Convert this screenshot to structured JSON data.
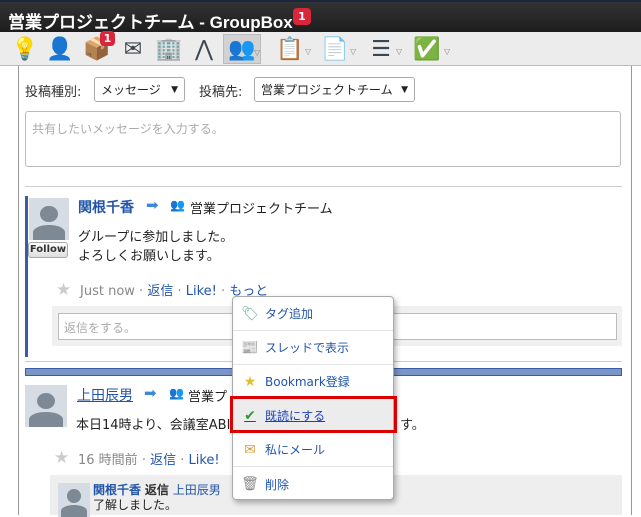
{
  "window": {
    "title": "営業プロジェクトチーム - GroupBox",
    "notification_count": "1"
  },
  "toolbar": {
    "items": [
      {
        "icon": "lightbulb-icon"
      },
      {
        "icon": "user-icon"
      },
      {
        "icon": "home-box-icon",
        "badge": "1"
      },
      {
        "icon": "mail-icon"
      },
      {
        "icon": "building-icon"
      },
      {
        "icon": "compass-icon"
      },
      {
        "icon": "group-icon",
        "active": true
      },
      {
        "icon": "clipboard-user-icon"
      },
      {
        "icon": "document-pin-icon"
      },
      {
        "icon": "list-icon"
      },
      {
        "icon": "checkbox-icon"
      }
    ]
  },
  "composer": {
    "type_label": "投稿種別:",
    "type_value": "メッセージ",
    "dest_label": "投稿先:",
    "dest_value": "営業プロジェクトチーム",
    "placeholder": "共有したいメッセージを入力する。"
  },
  "posts": [
    {
      "author": "関根千香",
      "target": "営業プロジェクトチーム",
      "follow": "Follow",
      "lines": [
        "グループに参加しました。",
        "よろしくお願いします。"
      ],
      "time": "Just now",
      "reply": "返信",
      "like": "Like!",
      "more": "もっと",
      "reply_placeholder": "返信をする。"
    },
    {
      "author": "上田辰男",
      "target": "営業プ",
      "text_start": "本日14時より、会議室ABI",
      "text_end": "す。",
      "time": "16 時間前",
      "reply": "返信",
      "like": "Like!",
      "replies": [
        {
          "author": "関根千香",
          "verb": "返信",
          "to": "上田辰男",
          "text": "了解しました。"
        }
      ]
    }
  ],
  "menu": {
    "items": [
      {
        "label": "タグ追加",
        "icon": "tag-add-icon"
      },
      {
        "label": "スレッドで表示",
        "icon": "thread-icon"
      },
      {
        "label": "Bookmark登録",
        "icon": "star-icon"
      },
      {
        "label": "既読にする",
        "icon": "check-icon",
        "highlighted": true
      },
      {
        "label": "私にメール",
        "icon": "mail-to-me-icon"
      },
      {
        "label": "削除",
        "icon": "trash-icon"
      }
    ]
  },
  "colors": {
    "accent": "#2255aa",
    "highlight": "#dd0000",
    "badge": "#d9263b"
  }
}
